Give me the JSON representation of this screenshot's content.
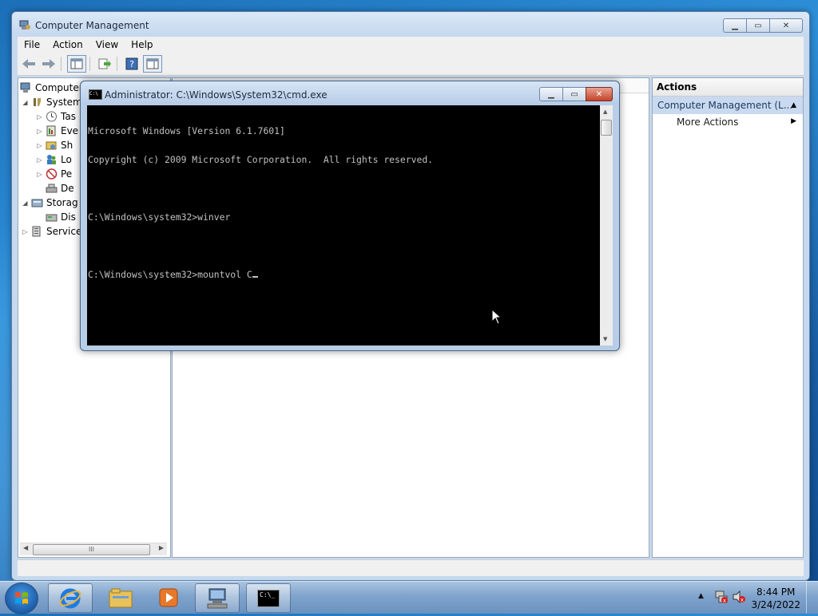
{
  "main_window": {
    "title": "Computer Management",
    "menu": [
      "File",
      "Action",
      "View",
      "Help"
    ],
    "tree": {
      "root": "Computer",
      "system": "System",
      "task": "Tas",
      "event": "Eve",
      "shared": "Sh",
      "local": "Lo",
      "perf": "Pe",
      "device": "De",
      "storage": "Storag",
      "disk": "Dis",
      "services": "Service"
    },
    "actions_pane": {
      "header": "Actions",
      "section": "Computer Management (L...",
      "more_actions": "More Actions"
    }
  },
  "cmd_window": {
    "title": "Administrator: C:\\Windows\\System32\\cmd.exe",
    "lines": [
      "Microsoft Windows [Version 6.1.7601]",
      "Copyright (c) 2009 Microsoft Corporation.  All rights reserved.",
      "",
      "C:\\Windows\\system32>winver",
      "",
      "C:\\Windows\\system32>mountvol C"
    ]
  },
  "taskbar": {
    "time": "8:44 PM",
    "date": "3/24/2022",
    "cmd_label": "C:\\_"
  }
}
